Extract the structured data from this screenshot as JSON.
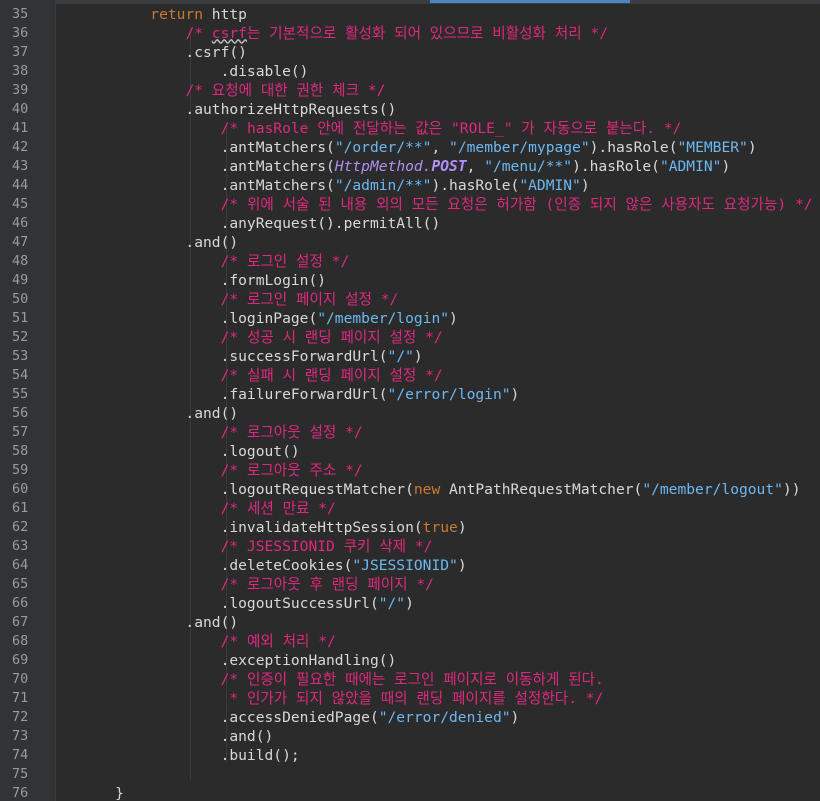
{
  "editor": {
    "lines": [
      {
        "n": "35",
        "tokens": [
          {
            "t": "        "
          },
          {
            "t": "return",
            "c": "kw"
          },
          {
            "t": " http"
          }
        ]
      },
      {
        "n": "36",
        "tokens": [
          {
            "t": "            "
          },
          {
            "t": "/* ",
            "c": "cm"
          },
          {
            "t": "csrf",
            "c": "cm squig"
          },
          {
            "t": "는 기본적으로 활성화 되어 있으므로 비활성화 처리 */",
            "c": "cm"
          }
        ]
      },
      {
        "n": "37",
        "tokens": [
          {
            "t": "            .csrf()"
          }
        ]
      },
      {
        "n": "38",
        "tokens": [
          {
            "t": "                .disable()"
          }
        ]
      },
      {
        "n": "39",
        "tokens": [
          {
            "t": "            "
          },
          {
            "t": "/* 요청에 대한 권한 체크 */",
            "c": "cm"
          }
        ]
      },
      {
        "n": "40",
        "tokens": [
          {
            "t": "            .authorizeHttpRequests()"
          }
        ]
      },
      {
        "n": "41",
        "tokens": [
          {
            "t": "                "
          },
          {
            "t": "/* hasRole 안에 전달하는 값은 \"ROLE_\" 가 자동으로 붙는다. */",
            "c": "cm"
          }
        ]
      },
      {
        "n": "42",
        "tokens": [
          {
            "t": "                .antMatchers("
          },
          {
            "t": "\"/order/**\"",
            "c": "str"
          },
          {
            "t": ", "
          },
          {
            "t": "\"/member/mypage\"",
            "c": "str"
          },
          {
            "t": ").hasRole("
          },
          {
            "t": "\"MEMBER\"",
            "c": "str"
          },
          {
            "t": ")"
          }
        ]
      },
      {
        "n": "43",
        "tokens": [
          {
            "t": "                .antMatchers("
          },
          {
            "t": "HttpMethod.",
            "c": "it"
          },
          {
            "t": "POST",
            "c": "const"
          },
          {
            "t": ", "
          },
          {
            "t": "\"/menu/**\"",
            "c": "str"
          },
          {
            "t": ").hasRole("
          },
          {
            "t": "\"ADMIN\"",
            "c": "str"
          },
          {
            "t": ")"
          }
        ]
      },
      {
        "n": "44",
        "tokens": [
          {
            "t": "                .antMatchers("
          },
          {
            "t": "\"/admin/**\"",
            "c": "str"
          },
          {
            "t": ").hasRole("
          },
          {
            "t": "\"ADMIN\"",
            "c": "str"
          },
          {
            "t": ")"
          }
        ]
      },
      {
        "n": "45",
        "tokens": [
          {
            "t": "                "
          },
          {
            "t": "/* 위에 서술 된 내용 외의 모든 요청은 허가함 (인증 되지 않은 사용자도 요청가능) */",
            "c": "cm"
          }
        ]
      },
      {
        "n": "46",
        "tokens": [
          {
            "t": "                .anyRequest().permitAll()"
          }
        ]
      },
      {
        "n": "47",
        "tokens": [
          {
            "t": "            .and()"
          }
        ]
      },
      {
        "n": "48",
        "tokens": [
          {
            "t": "                "
          },
          {
            "t": "/* 로그인 설정 */",
            "c": "cm"
          }
        ]
      },
      {
        "n": "49",
        "tokens": [
          {
            "t": "                .formLogin()"
          }
        ]
      },
      {
        "n": "50",
        "tokens": [
          {
            "t": "                "
          },
          {
            "t": "/* 로그인 페이지 설정 */",
            "c": "cm"
          }
        ]
      },
      {
        "n": "51",
        "tokens": [
          {
            "t": "                .loginPage("
          },
          {
            "t": "\"/member/login\"",
            "c": "str"
          },
          {
            "t": ")"
          }
        ]
      },
      {
        "n": "52",
        "tokens": [
          {
            "t": "                "
          },
          {
            "t": "/* 성공 시 랜딩 페이지 설정 */",
            "c": "cm"
          }
        ]
      },
      {
        "n": "53",
        "tokens": [
          {
            "t": "                .successForwardUrl("
          },
          {
            "t": "\"/\"",
            "c": "str"
          },
          {
            "t": ")"
          }
        ]
      },
      {
        "n": "54",
        "tokens": [
          {
            "t": "                "
          },
          {
            "t": "/* 실패 시 랜딩 페이지 설정 */",
            "c": "cm"
          }
        ]
      },
      {
        "n": "55",
        "tokens": [
          {
            "t": "                .failureForwardUrl("
          },
          {
            "t": "\"/error/login\"",
            "c": "str"
          },
          {
            "t": ")"
          }
        ]
      },
      {
        "n": "56",
        "tokens": [
          {
            "t": "            .and()"
          }
        ]
      },
      {
        "n": "57",
        "tokens": [
          {
            "t": "                "
          },
          {
            "t": "/* 로그아웃 설정 */",
            "c": "cm"
          }
        ]
      },
      {
        "n": "58",
        "tokens": [
          {
            "t": "                .logout()"
          }
        ]
      },
      {
        "n": "59",
        "tokens": [
          {
            "t": "                "
          },
          {
            "t": "/* 로그아웃 주소 */",
            "c": "cm"
          }
        ]
      },
      {
        "n": "60",
        "tokens": [
          {
            "t": "                .logoutRequestMatcher("
          },
          {
            "t": "new",
            "c": "kw"
          },
          {
            "t": " AntPathRequestMatcher("
          },
          {
            "t": "\"/member/logout\"",
            "c": "str"
          },
          {
            "t": "))"
          }
        ]
      },
      {
        "n": "61",
        "tokens": [
          {
            "t": "                "
          },
          {
            "t": "/* 세션 만료 */",
            "c": "cm"
          }
        ]
      },
      {
        "n": "62",
        "tokens": [
          {
            "t": "                .invalidateHttpSession("
          },
          {
            "t": "true",
            "c": "kw"
          },
          {
            "t": ")"
          }
        ]
      },
      {
        "n": "63",
        "tokens": [
          {
            "t": "                "
          },
          {
            "t": "/* JSESSIONID 쿠키 삭제 */",
            "c": "cm"
          }
        ]
      },
      {
        "n": "64",
        "tokens": [
          {
            "t": "                .deleteCookies("
          },
          {
            "t": "\"JSESSIONID\"",
            "c": "str"
          },
          {
            "t": ")"
          }
        ]
      },
      {
        "n": "65",
        "tokens": [
          {
            "t": "                "
          },
          {
            "t": "/* 로그아웃 후 랜딩 페이지 */",
            "c": "cm"
          }
        ]
      },
      {
        "n": "66",
        "tokens": [
          {
            "t": "                .logoutSuccessUrl("
          },
          {
            "t": "\"/\"",
            "c": "str"
          },
          {
            "t": ")"
          }
        ]
      },
      {
        "n": "67",
        "tokens": [
          {
            "t": "            .and()"
          }
        ]
      },
      {
        "n": "68",
        "tokens": [
          {
            "t": "                "
          },
          {
            "t": "/* 예외 처리 */",
            "c": "cm"
          }
        ]
      },
      {
        "n": "69",
        "tokens": [
          {
            "t": "                .exceptionHandling()"
          }
        ]
      },
      {
        "n": "70",
        "tokens": [
          {
            "t": "                "
          },
          {
            "t": "/* 인증이 필요한 때에는 로그인 페이지로 이동하게 된다.",
            "c": "cm"
          }
        ]
      },
      {
        "n": "71",
        "tokens": [
          {
            "t": "                "
          },
          {
            "t": " * 인가가 되지 않았을 때의 랜딩 페이지를 설정한다. */",
            "c": "cm"
          }
        ]
      },
      {
        "n": "72",
        "tokens": [
          {
            "t": "                .accessDeniedPage("
          },
          {
            "t": "\"/error/denied\"",
            "c": "str"
          },
          {
            "t": ")"
          }
        ]
      },
      {
        "n": "73",
        "tokens": [
          {
            "t": "                .and()"
          }
        ]
      },
      {
        "n": "74",
        "tokens": [
          {
            "t": "                .build();"
          }
        ]
      },
      {
        "n": "75",
        "tokens": []
      },
      {
        "n": "76",
        "tokens": [
          {
            "t": "    }"
          }
        ]
      }
    ]
  },
  "colors": {
    "background": "#2b2b2b",
    "gutter": "#313335",
    "line_number": "#9b9b9b",
    "text": "#d8d8d8",
    "keyword": "#cc7832",
    "comment": "#e0287f",
    "string": "#6cb8f2",
    "static_field": "#b28ef5",
    "tab_indicator": "#4a88c7"
  }
}
